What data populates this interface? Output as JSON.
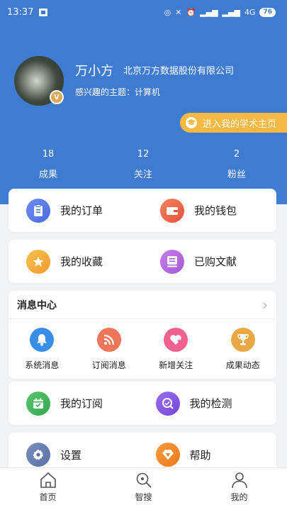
{
  "status_bar": {
    "time": "13:37",
    "network": "4G",
    "battery": "76"
  },
  "profile": {
    "name": "万小方",
    "company": "北京万方数据股份有限公司",
    "interest": "感兴趣的主题：计算机",
    "badge": "V",
    "homepage_button": "进入我的学术主页"
  },
  "stats": [
    {
      "value": "18",
      "label": "成果"
    },
    {
      "value": "12",
      "label": "关注"
    },
    {
      "value": "2",
      "label": "粉丝"
    }
  ],
  "menu": {
    "orders": "我的订单",
    "wallet": "我的钱包",
    "favorites": "我的收藏",
    "purchased": "已购文献",
    "subscriptions": "我的订阅",
    "detection": "我的检测",
    "settings": "设置",
    "help": "帮助"
  },
  "messages": {
    "title": "消息中心",
    "items": [
      {
        "label": "系统消息",
        "icon": "bell-icon",
        "color": "#3a8ee8"
      },
      {
        "label": "订阅消息",
        "icon": "rss-icon",
        "color": "#f0765a"
      },
      {
        "label": "新增关注",
        "icon": "heart-plus-icon",
        "color": "#f0618f"
      },
      {
        "label": "成果动态",
        "icon": "trophy-icon",
        "color": "#eaa845"
      }
    ]
  },
  "tabs": [
    {
      "label": "首页",
      "icon": "home-icon"
    },
    {
      "label": "智搜",
      "icon": "search-icon"
    },
    {
      "label": "我的",
      "icon": "person-icon"
    }
  ],
  "colors": {
    "header_blue": "#3f7bd0",
    "accent_orange": "#f4b843"
  }
}
